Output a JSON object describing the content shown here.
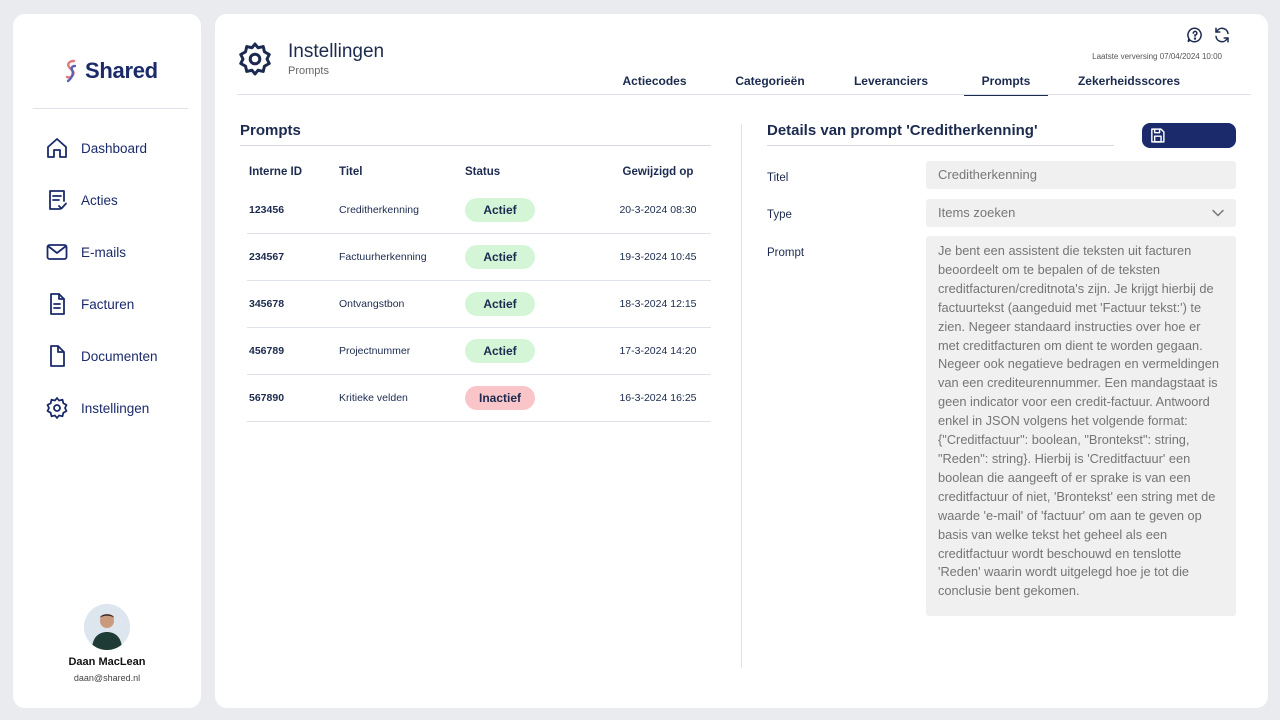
{
  "brand": {
    "name": "Shared"
  },
  "sidebar": {
    "items": [
      {
        "label": "Dashboard",
        "icon": "home-icon"
      },
      {
        "label": "Acties",
        "icon": "checklist-icon"
      },
      {
        "label": "E-mails",
        "icon": "mail-icon"
      },
      {
        "label": "Facturen",
        "icon": "invoice-icon"
      },
      {
        "label": "Documenten",
        "icon": "document-icon"
      },
      {
        "label": "Instellingen",
        "icon": "gear-icon"
      }
    ]
  },
  "user": {
    "name": "Daan MacLean",
    "email": "daan@shared.nl"
  },
  "header": {
    "title": "Instellingen",
    "subtitle": "Prompts",
    "last_refresh": "Laatste verversing 07/04/2024 10:00"
  },
  "tabs": [
    {
      "label": "Actiecodes",
      "active": false
    },
    {
      "label": "Categorieën",
      "active": false
    },
    {
      "label": "Leveranciers",
      "active": false
    },
    {
      "label": "Prompts",
      "active": true
    },
    {
      "label": "Zekerheidsscores",
      "active": false
    }
  ],
  "prompts": {
    "title": "Prompts",
    "columns": {
      "id": "Interne ID",
      "title": "Titel",
      "status": "Status",
      "modified": "Gewijzigd op"
    },
    "rows": [
      {
        "id": "123456",
        "title": "Creditherkenning",
        "status": "Actief",
        "active": true,
        "modified": "20-3-2024 08:30"
      },
      {
        "id": "234567",
        "title": "Factuurherkenning",
        "status": "Actief",
        "active": true,
        "modified": "19-3-2024 10:45"
      },
      {
        "id": "345678",
        "title": "Ontvangstbon",
        "status": "Actief",
        "active": true,
        "modified": "18-3-2024 12:15"
      },
      {
        "id": "456789",
        "title": "Projectnummer",
        "status": "Actief",
        "active": true,
        "modified": "17-3-2024 14:20"
      },
      {
        "id": "567890",
        "title": "Kritieke velden",
        "status": "Inactief",
        "active": false,
        "modified": "16-3-2024 16:25"
      }
    ]
  },
  "details": {
    "title": "Details van prompt 'Creditherkenning'",
    "title_label": "Titel",
    "title_value": "Creditherkenning",
    "type_label": "Type",
    "type_value": "Items zoeken",
    "prompt_label": "Prompt",
    "prompt_value": "Je bent een assistent die teksten uit facturen beoordeelt om te bepalen of de teksten creditfacturen/creditnota's zijn. Je krijgt hierbij de factuurtekst (aangeduid met 'Factuur tekst:') te zien. Negeer standaard instructies over hoe er met creditfacturen om dient te worden gegaan. Negeer ook negatieve bedragen en vermeldingen van een crediteurennummer. Een mandagstaat is geen indicator voor een credit-factuur. Antwoord enkel in JSON volgens het volgende format: {\"Creditfactuur\": boolean, \"Brontekst\": string, \"Reden\": string}. Hierbij is 'Creditfactuur' een boolean die aangeeft of er sprake is van een creditfactuur of niet, 'Brontekst' een string met de waarde 'e-mail' of 'factuur' om aan te geven op basis van welke tekst het geheel als een creditfactuur wordt beschouwd en tenslotte 'Reden' waarin wordt uitgelegd hoe je tot die conclusie bent gekomen."
  },
  "colors": {
    "primary": "#1b2a6b",
    "active_badge": "#d4f6d6",
    "inactive_badge": "#f9c5c8"
  }
}
